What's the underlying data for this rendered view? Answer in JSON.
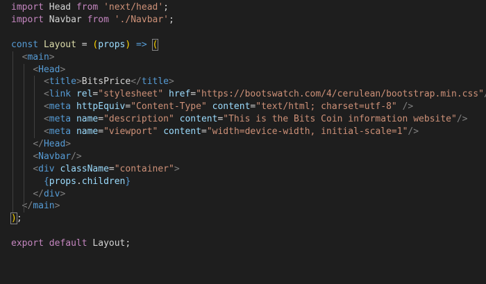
{
  "editor": {
    "theme_colors": {
      "background": "#1e1e1e",
      "keyword": "#c586c0",
      "storage": "#569cd6",
      "string": "#ce9178",
      "attribute": "#9cdcfe",
      "bracket": "#808080",
      "text": "#d4d4d4"
    },
    "lines": [
      {
        "tokens": [
          {
            "t": "import",
            "c": "kw"
          },
          {
            "t": " Head ",
            "c": "id"
          },
          {
            "t": "from",
            "c": "kw"
          },
          {
            "t": " ",
            "c": "id"
          },
          {
            "t": "'next/head'",
            "c": "str"
          },
          {
            "t": ";",
            "c": "id"
          }
        ]
      },
      {
        "tokens": [
          {
            "t": "import",
            "c": "kw"
          },
          {
            "t": " Navbar ",
            "c": "id"
          },
          {
            "t": "from",
            "c": "kw"
          },
          {
            "t": " ",
            "c": "id"
          },
          {
            "t": "'./Navbar'",
            "c": "str"
          },
          {
            "t": ";",
            "c": "id"
          }
        ]
      },
      {
        "tokens": []
      },
      {
        "tokens": [
          {
            "t": "const",
            "c": "kw2"
          },
          {
            "t": " ",
            "c": "id"
          },
          {
            "t": "Layout",
            "c": "fn"
          },
          {
            "t": " = ",
            "c": "id"
          },
          {
            "t": "(",
            "c": "paren-y"
          },
          {
            "t": "props",
            "c": "var"
          },
          {
            "t": ")",
            "c": "paren-y"
          },
          {
            "t": " ",
            "c": "id"
          },
          {
            "t": "=>",
            "c": "arrow"
          },
          {
            "t": " ",
            "c": "id"
          },
          {
            "t": "(",
            "c": "paren-hl"
          }
        ]
      },
      {
        "tokens": [
          {
            "t": "  ",
            "c": "id"
          },
          {
            "t": "<",
            "c": "br"
          },
          {
            "t": "main",
            "c": "tag"
          },
          {
            "t": ">",
            "c": "br"
          }
        ]
      },
      {
        "tokens": [
          {
            "t": "    ",
            "c": "id"
          },
          {
            "t": "<",
            "c": "br"
          },
          {
            "t": "Head",
            "c": "tag"
          },
          {
            "t": ">",
            "c": "br"
          }
        ]
      },
      {
        "tokens": [
          {
            "t": "      ",
            "c": "id"
          },
          {
            "t": "<",
            "c": "br"
          },
          {
            "t": "title",
            "c": "tag"
          },
          {
            "t": ">",
            "c": "br"
          },
          {
            "t": "BitsPrice",
            "c": "id"
          },
          {
            "t": "</",
            "c": "br"
          },
          {
            "t": "title",
            "c": "tag"
          },
          {
            "t": ">",
            "c": "br"
          }
        ]
      },
      {
        "tokens": [
          {
            "t": "      ",
            "c": "id"
          },
          {
            "t": "<",
            "c": "br"
          },
          {
            "t": "link",
            "c": "tag"
          },
          {
            "t": " ",
            "c": "id"
          },
          {
            "t": "rel",
            "c": "attr"
          },
          {
            "t": "=",
            "c": "id"
          },
          {
            "t": "\"stylesheet\"",
            "c": "str"
          },
          {
            "t": " ",
            "c": "id"
          },
          {
            "t": "href",
            "c": "attr"
          },
          {
            "t": "=",
            "c": "id"
          },
          {
            "t": "\"https://bootswatch.com/4/cerulean/bootstrap.min.css\"",
            "c": "str"
          },
          {
            "t": "/>",
            "c": "br"
          }
        ]
      },
      {
        "tokens": [
          {
            "t": "      ",
            "c": "id"
          },
          {
            "t": "<",
            "c": "br"
          },
          {
            "t": "meta",
            "c": "tag"
          },
          {
            "t": " ",
            "c": "id"
          },
          {
            "t": "httpEquiv",
            "c": "attr"
          },
          {
            "t": "=",
            "c": "id"
          },
          {
            "t": "\"Content-Type\"",
            "c": "str"
          },
          {
            "t": " ",
            "c": "id"
          },
          {
            "t": "content",
            "c": "attr"
          },
          {
            "t": "=",
            "c": "id"
          },
          {
            "t": "\"text/html; charset=utf-8\"",
            "c": "str"
          },
          {
            "t": " ",
            "c": "id"
          },
          {
            "t": "/>",
            "c": "br"
          }
        ]
      },
      {
        "tokens": [
          {
            "t": "      ",
            "c": "id"
          },
          {
            "t": "<",
            "c": "br"
          },
          {
            "t": "meta",
            "c": "tag"
          },
          {
            "t": " ",
            "c": "id"
          },
          {
            "t": "name",
            "c": "attr"
          },
          {
            "t": "=",
            "c": "id"
          },
          {
            "t": "\"description\"",
            "c": "str"
          },
          {
            "t": " ",
            "c": "id"
          },
          {
            "t": "content",
            "c": "attr"
          },
          {
            "t": "=",
            "c": "id"
          },
          {
            "t": "\"This is the Bits Coin information website\"",
            "c": "str"
          },
          {
            "t": "/>",
            "c": "br"
          }
        ]
      },
      {
        "tokens": [
          {
            "t": "      ",
            "c": "id"
          },
          {
            "t": "<",
            "c": "br"
          },
          {
            "t": "meta",
            "c": "tag"
          },
          {
            "t": " ",
            "c": "id"
          },
          {
            "t": "name",
            "c": "attr"
          },
          {
            "t": "=",
            "c": "id"
          },
          {
            "t": "\"viewport\"",
            "c": "str"
          },
          {
            "t": " ",
            "c": "id"
          },
          {
            "t": "content",
            "c": "attr"
          },
          {
            "t": "=",
            "c": "id"
          },
          {
            "t": "\"width=device-width, initial-scale=1\"",
            "c": "str"
          },
          {
            "t": "/>",
            "c": "br"
          }
        ]
      },
      {
        "tokens": [
          {
            "t": "    ",
            "c": "id"
          },
          {
            "t": "</",
            "c": "br"
          },
          {
            "t": "Head",
            "c": "tag"
          },
          {
            "t": ">",
            "c": "br"
          }
        ]
      },
      {
        "tokens": [
          {
            "t": "    ",
            "c": "id"
          },
          {
            "t": "<",
            "c": "br"
          },
          {
            "t": "Navbar",
            "c": "tag"
          },
          {
            "t": "/>",
            "c": "br"
          }
        ]
      },
      {
        "tokens": [
          {
            "t": "    ",
            "c": "id"
          },
          {
            "t": "<",
            "c": "br"
          },
          {
            "t": "div",
            "c": "tag"
          },
          {
            "t": " ",
            "c": "id"
          },
          {
            "t": "className",
            "c": "attr"
          },
          {
            "t": "=",
            "c": "id"
          },
          {
            "t": "\"container\"",
            "c": "str"
          },
          {
            "t": ">",
            "c": "br"
          }
        ]
      },
      {
        "tokens": [
          {
            "t": "      ",
            "c": "id"
          },
          {
            "t": "{",
            "c": "kw2"
          },
          {
            "t": "props",
            "c": "var"
          },
          {
            "t": ".",
            "c": "id"
          },
          {
            "t": "children",
            "c": "var"
          },
          {
            "t": "}",
            "c": "kw2"
          }
        ]
      },
      {
        "tokens": [
          {
            "t": "    ",
            "c": "id"
          },
          {
            "t": "</",
            "c": "br"
          },
          {
            "t": "div",
            "c": "tag"
          },
          {
            "t": ">",
            "c": "br"
          }
        ]
      },
      {
        "tokens": [
          {
            "t": "  ",
            "c": "id"
          },
          {
            "t": "</",
            "c": "br"
          },
          {
            "t": "main",
            "c": "tag"
          },
          {
            "t": ">",
            "c": "br"
          }
        ]
      },
      {
        "tokens": [
          {
            "t": ")",
            "c": "paren-hl"
          },
          {
            "t": ";",
            "c": "id"
          }
        ]
      },
      {
        "tokens": []
      },
      {
        "tokens": [
          {
            "t": "export",
            "c": "kw"
          },
          {
            "t": " ",
            "c": "id"
          },
          {
            "t": "default",
            "c": "kw"
          },
          {
            "t": " Layout;",
            "c": "id"
          }
        ]
      }
    ]
  }
}
